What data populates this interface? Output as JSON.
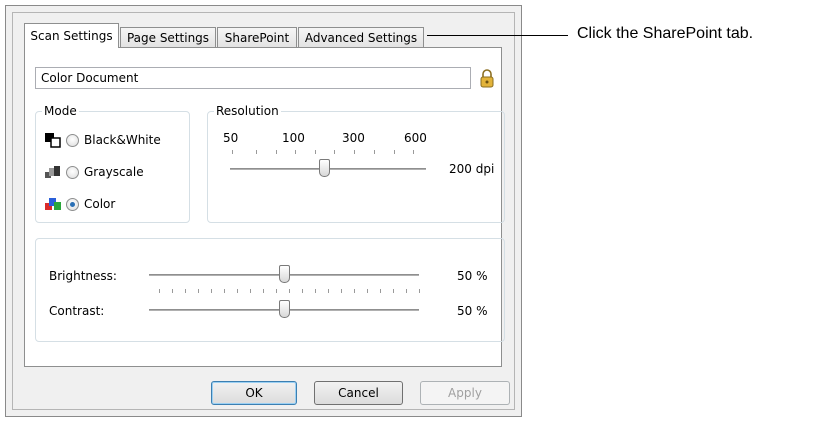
{
  "tabs": [
    {
      "label": "Scan Settings",
      "active": true
    },
    {
      "label": "Page Settings",
      "active": false
    },
    {
      "label": "SharePoint",
      "active": false
    },
    {
      "label": "Advanced Settings",
      "active": false
    }
  ],
  "scan_name": "Color Document",
  "mode": {
    "title": "Mode",
    "options": [
      {
        "label": "Black&White",
        "icon": "black-white-icon",
        "selected": false
      },
      {
        "label": "Grayscale",
        "icon": "grayscale-icon",
        "selected": false
      },
      {
        "label": "Color",
        "icon": "color-icon",
        "selected": true
      }
    ]
  },
  "resolution": {
    "title": "Resolution",
    "scale_labels": [
      "50",
      "100",
      "300",
      "600"
    ],
    "value_text": "200 dpi"
  },
  "adjustments": {
    "brightness": {
      "label": "Brightness:",
      "value_text": "50 %",
      "level": 0.5
    },
    "contrast": {
      "label": "Contrast:",
      "value_text": "50 %",
      "level": 0.5
    }
  },
  "buttons": {
    "ok": "OK",
    "cancel": "Cancel",
    "apply": "Apply"
  },
  "callout": "Click the SharePoint tab.",
  "colors": {
    "accent": "#2a6fb5",
    "dialog_bg": "#f0f0f0",
    "lock": "#d9a520"
  }
}
